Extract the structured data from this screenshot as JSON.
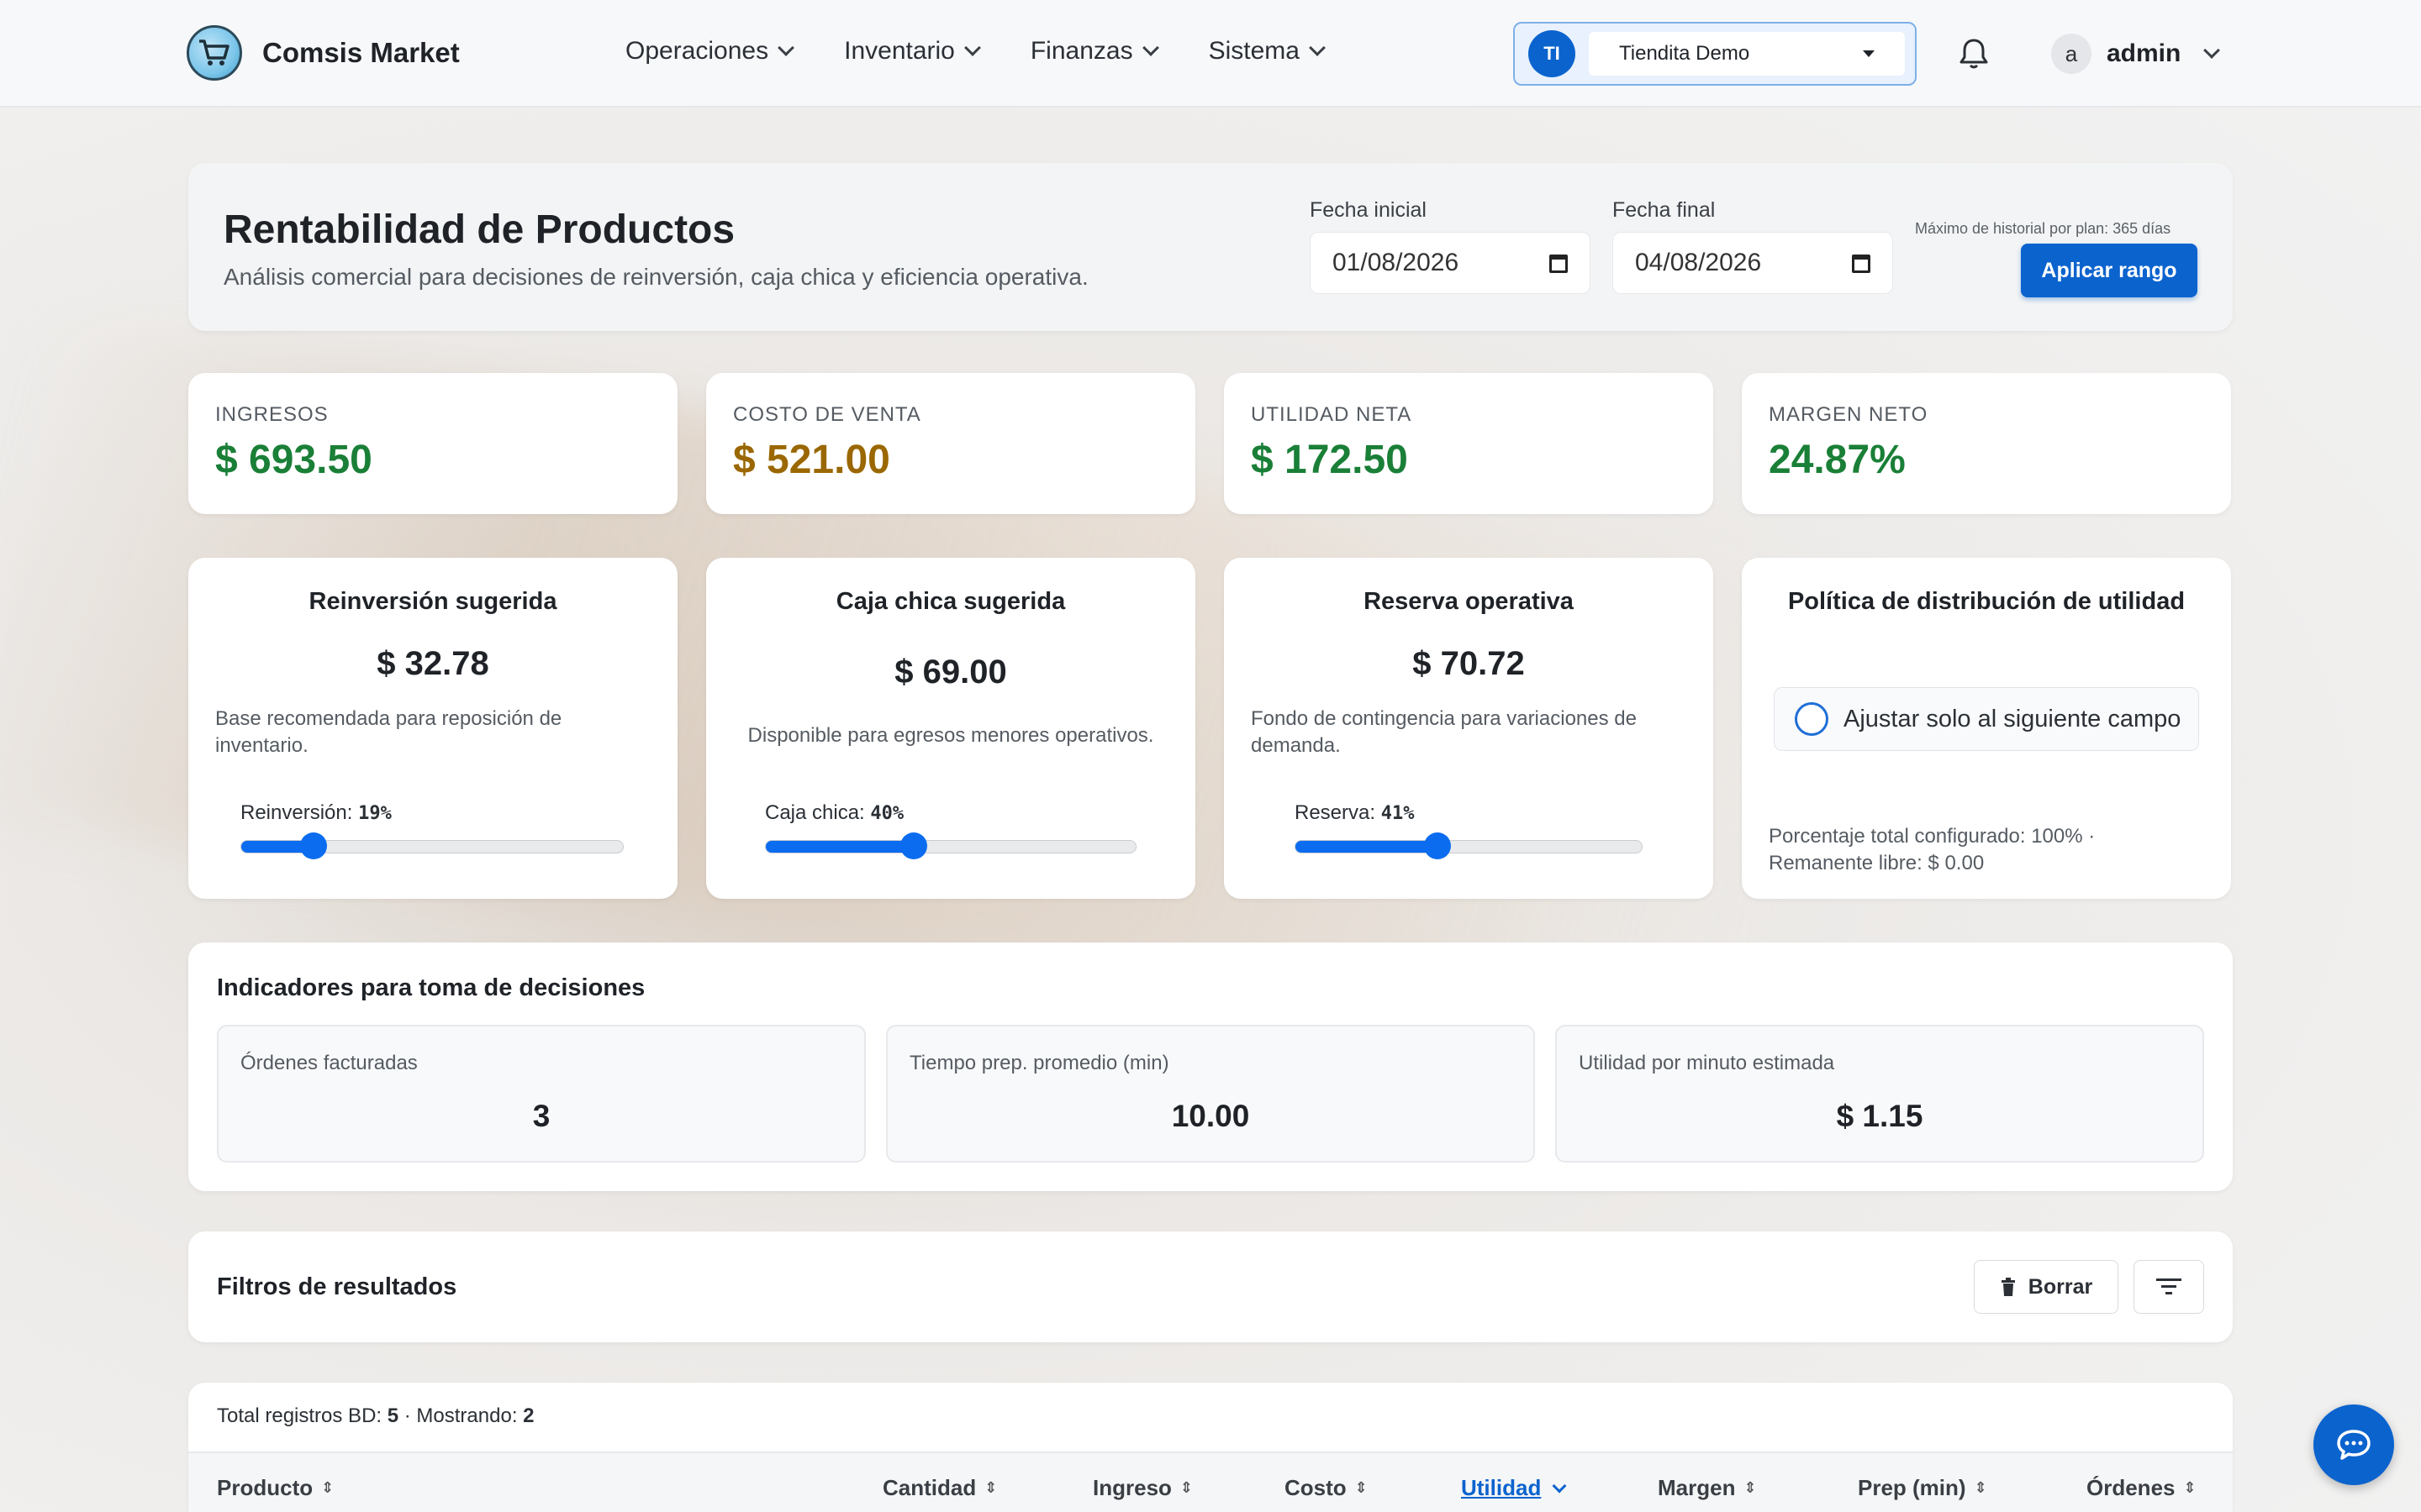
{
  "header": {
    "brand": "Comsis Market",
    "nav": [
      {
        "label": "Operaciones"
      },
      {
        "label": "Inventario"
      },
      {
        "label": "Finanzas"
      },
      {
        "label": "Sistema"
      }
    ],
    "store": {
      "initials": "TI",
      "selected": "Tiendita Demo"
    },
    "user": {
      "initial": "a",
      "name": "admin"
    }
  },
  "hero": {
    "title": "Rentabilidad de Productos",
    "subtitle": "Análisis comercial para decisiones de reinversión, caja chica y eficiencia operativa.",
    "start_label": "Fecha inicial",
    "start_value": "01/08/2026",
    "end_label": "Fecha final",
    "end_value": "04/08/2026",
    "plan_note": "Máximo de historial por plan: 365 días",
    "apply_label": "Aplicar rango"
  },
  "kpis": [
    {
      "label": "INGRESOS",
      "value": "$ 693.50",
      "color": "#1a7f37"
    },
    {
      "label": "COSTO DE VENTA",
      "value": "$ 521.00",
      "color": "#9a6700"
    },
    {
      "label": "UTILIDAD NETA",
      "value": "$ 172.50",
      "color": "#1a7f37"
    },
    {
      "label": "MARGEN NETO",
      "value": "24.87%",
      "color": "#1a7f37"
    }
  ],
  "allocations": [
    {
      "title": "Reinversión sugerida",
      "value": "$ 32.78",
      "desc": "Base recomendada para reposición de inventario.",
      "slider_label": "Reinversión:",
      "slider_pct_text": "19%",
      "pct": 19
    },
    {
      "title": "Caja chica sugerida",
      "value": "$ 69.00",
      "desc": "Disponible para egresos menores operativos.",
      "slider_label": "Caja chica:",
      "slider_pct_text": "40%",
      "pct": 40
    },
    {
      "title": "Reserva operativa",
      "value": "$ 70.72",
      "desc": "Fondo de contingencia para variaciones de demanda.",
      "slider_label": "Reserva:",
      "slider_pct_text": "41%",
      "pct": 41
    }
  ],
  "policy": {
    "title": "Política de distribución de utilidad",
    "checkbox_label": "Ajustar solo al siguiente campo",
    "note": "Porcentaje total configurado: 100% · Remanente libre: $ 0.00"
  },
  "indicators": {
    "title": "Indicadores para toma de decisiones",
    "items": [
      {
        "label": "Órdenes facturadas",
        "value": "3"
      },
      {
        "label": "Tiempo prep. promedio (min)",
        "value": "10.00"
      },
      {
        "label": "Utilidad por minuto estimada",
        "value": "$ 1.15"
      }
    ]
  },
  "filters": {
    "title": "Filtros de resultados",
    "clear_label": "Borrar"
  },
  "table": {
    "total_prefix": "Total registros BD: ",
    "total": "5",
    "showing_prefix": " · Mostrando: ",
    "showing": "2",
    "columns": [
      "Producto",
      "Cantidad",
      "Ingreso",
      "Costo",
      "Utilidad",
      "Margen",
      "Prep (min)",
      "Órdenes"
    ]
  }
}
